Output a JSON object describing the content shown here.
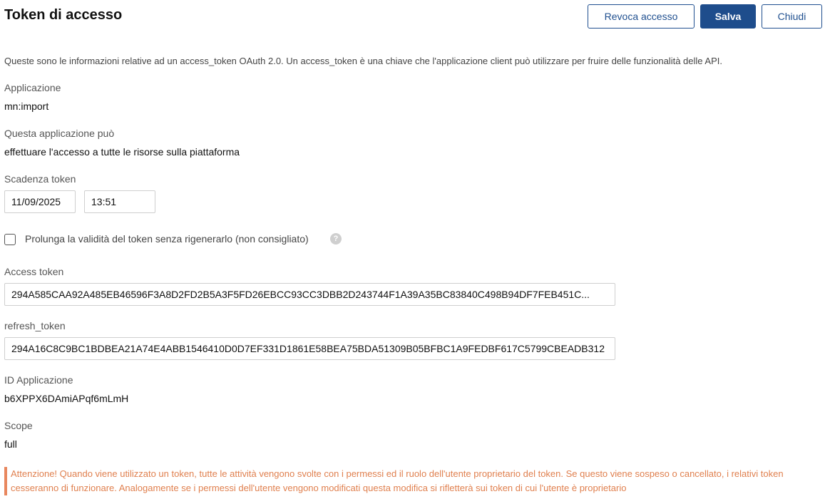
{
  "header": {
    "title": "Token di accesso"
  },
  "toolbar": {
    "revoke_label": "Revoca accesso",
    "save_label": "Salva",
    "close_label": "Chiudi"
  },
  "intro": "Queste sono le informazioni relative ad un access_token OAuth 2.0. Un access_token è una chiave che l'applicazione client può utilizzare per fruire delle funzionalità delle API.",
  "application": {
    "label": "Applicazione",
    "value": "mn:import"
  },
  "permissions": {
    "label": "Questa applicazione può",
    "value": "effettuare l'accesso a tutte le risorse sulla piattaforma"
  },
  "expiry": {
    "label": "Scadenza token",
    "date": "11/09/2025",
    "time": "13:51"
  },
  "extend": {
    "label": "Prolunga la validità del token senza rigenerarlo (non consigliato)",
    "checked": false,
    "help_icon": "question-circle-icon"
  },
  "access_token": {
    "label": "Access token",
    "value": "294A585CAA92A485EB46596F3A8D2FD2B5A3F5FD26EBCC93CC3DBB2D243744F1A39A35BC83840C498B94DF7FEB451C..."
  },
  "refresh_token": {
    "label": "refresh_token",
    "value": "294A16C8C9BC1BDBEA21A74E4ABB1546410D0D7EF331D1861E58BEA75BDA51309B05BFBC1A9FEDBF617C5799CBEADB312"
  },
  "app_id": {
    "label": "ID Applicazione",
    "value": "b6XPPX6DAmiAPqf6mLmH"
  },
  "scope": {
    "label": "Scope",
    "value": "full"
  },
  "warning": "Attenzione! Quando viene utilizzato un token, tutte le attività vengono svolte con i permessi ed il ruolo dell'utente proprietario del token. Se questo viene sospeso o cancellato, i relativi token cesseranno di funzionare. Analogamente se i permessi dell'utente vengono modificati questa modifica si rifletterà sui token di cui l'utente è proprietario",
  "colors": {
    "primary": "#1e4d8c",
    "warning": "#e0804f"
  }
}
